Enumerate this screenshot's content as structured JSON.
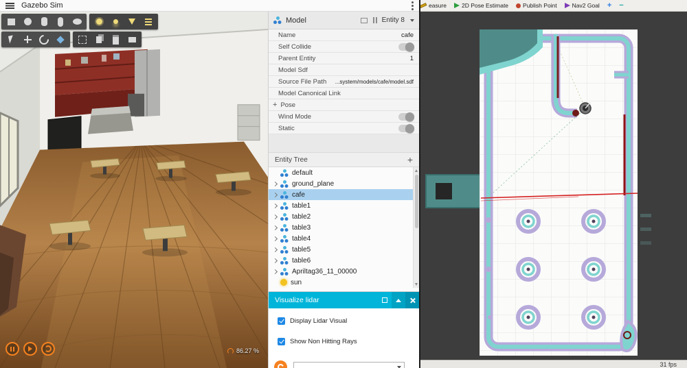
{
  "gazebo": {
    "title": "Gazebo Sim",
    "toolbar": {
      "shapes": [
        {
          "icon": "box-icon"
        },
        {
          "icon": "sphere-icon"
        },
        {
          "icon": "cylinder-icon"
        },
        {
          "icon": "capsule-icon"
        },
        {
          "icon": "ellipsoid-icon"
        }
      ],
      "lights": [
        {
          "icon": "sun-light-icon"
        },
        {
          "icon": "point-light-icon"
        },
        {
          "icon": "spot-light-icon"
        },
        {
          "icon": "dir-light-icon"
        }
      ],
      "transform": [
        {
          "icon": "select-icon"
        },
        {
          "icon": "translate-icon"
        },
        {
          "icon": "rotate-icon"
        },
        {
          "icon": "snap-icon"
        }
      ],
      "edit": [
        {
          "icon": "align-icon"
        },
        {
          "icon": "copy-icon"
        },
        {
          "icon": "paste-icon"
        },
        {
          "icon": "record-icon"
        }
      ]
    },
    "playback": [
      {
        "icon": "pause-icon",
        "name": "pause-button"
      },
      {
        "icon": "step-icon",
        "name": "step-button"
      },
      {
        "icon": "rtf-icon",
        "name": "rtf-button"
      }
    ],
    "viewport": {
      "rtf": "86.27 %"
    },
    "model_panel": {
      "title": "Model",
      "entity": "Entity 8",
      "properties": [
        {
          "label": "Name",
          "type": "text",
          "value": "cafe"
        },
        {
          "label": "Self Collide",
          "type": "toggle",
          "on": false
        },
        {
          "label": "Parent Entity",
          "type": "text",
          "value": "1"
        },
        {
          "label": "Model Sdf",
          "type": "text",
          "value": ""
        },
        {
          "label": "Source File Path",
          "type": "text",
          "value": "...system/models/cafe/model.sdf",
          "small": true
        },
        {
          "label": "Model Canonical Link",
          "type": "text",
          "value": ""
        },
        {
          "label": "Pose",
          "type": "expand",
          "prefix": "+"
        },
        {
          "label": "Wind Mode",
          "type": "toggle",
          "on": false
        },
        {
          "label": "Static",
          "type": "toggle",
          "on": false
        }
      ]
    },
    "entity_tree": {
      "title": "Entity Tree",
      "add_label": "+",
      "items": [
        {
          "label": "default",
          "icon": "model-icon",
          "expandable": false,
          "selected": false
        },
        {
          "label": "ground_plane",
          "icon": "model-icon",
          "expandable": true,
          "selected": false
        },
        {
          "label": "cafe",
          "icon": "model-icon",
          "expandable": true,
          "selected": true
        },
        {
          "label": "table1",
          "icon": "model-icon",
          "expandable": true,
          "selected": false
        },
        {
          "label": "table2",
          "icon": "model-icon",
          "expandable": true,
          "selected": false
        },
        {
          "label": "table3",
          "icon": "model-icon",
          "expandable": true,
          "selected": false
        },
        {
          "label": "table4",
          "icon": "model-icon",
          "expandable": true,
          "selected": false
        },
        {
          "label": "table5",
          "icon": "model-icon",
          "expandable": true,
          "selected": false
        },
        {
          "label": "table6",
          "icon": "model-icon",
          "expandable": true,
          "selected": false
        },
        {
          "label": "Apriltag36_11_00000",
          "icon": "model-icon",
          "expandable": true,
          "selected": false
        },
        {
          "label": "sun",
          "icon": "sun-icon",
          "expandable": false,
          "selected": false
        }
      ]
    },
    "lidar_panel": {
      "title": "Visualize lidar",
      "checkboxes": [
        {
          "label": "Display Lidar Visual",
          "checked": true
        },
        {
          "label": "Show Non Hitting Rays",
          "checked": true
        }
      ]
    }
  },
  "rviz": {
    "toolbar": [
      {
        "name": "measure-button",
        "label": "easure",
        "icon": "measure-icon"
      },
      {
        "name": "pose-estimate-button",
        "label": "2D Pose Estimate",
        "icon": "pose-estimate-icon"
      },
      {
        "name": "publish-point-button",
        "label": "Publish Point",
        "icon": "publish-point-icon"
      },
      {
        "name": "nav2-goal-button",
        "label": "Nav2 Goal",
        "icon": "nav2-goal-icon"
      },
      {
        "name": "zoom-in-button",
        "label": "+",
        "icon": "",
        "label_color": "#2d7de0"
      },
      {
        "name": "zoom-out-button",
        "label": "−",
        "icon": "",
        "label_color": "#1fa8a0"
      }
    ],
    "fps": "31 fps"
  },
  "colors": {
    "lidar_header": "#00b5d9",
    "selection": "#a9d1ef",
    "accent_orange": "#f58220",
    "checkbox_blue": "#1e88e5",
    "map_wall_teal": "#7fd4cf",
    "map_inflation_purple": "#b6a9da",
    "map_unknown_teal": "#4f8c89",
    "rviz_background": "#3d3d3d"
  }
}
